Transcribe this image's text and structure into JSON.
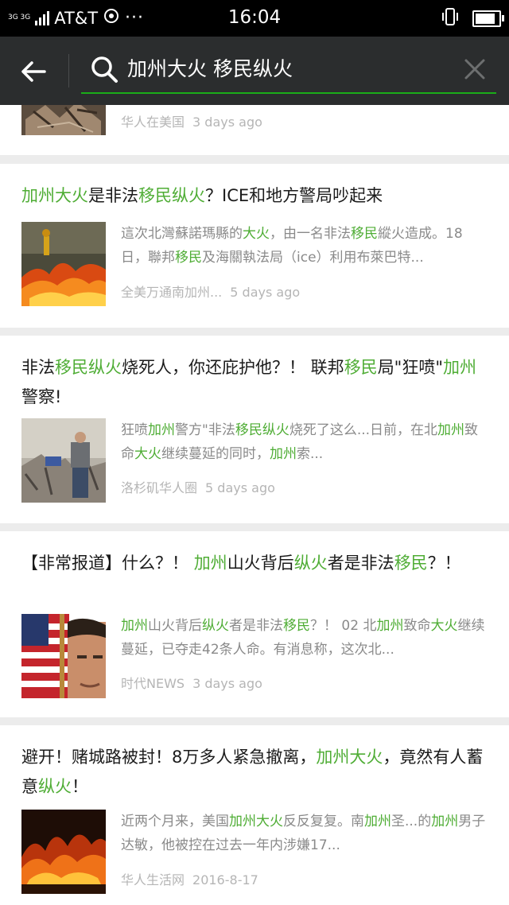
{
  "status_bar": {
    "network_type": "3G 3G",
    "carrier": "AT&T",
    "time": "16:04"
  },
  "search": {
    "query": "加州大火 移民纵火"
  },
  "results": [
    {
      "title": [],
      "snippet": [],
      "source": "华人在美国",
      "date": "3 days ago"
    },
    {
      "title": [
        {
          "t": "加州大火",
          "hl": true
        },
        {
          "t": "是非法",
          "hl": false
        },
        {
          "t": "移民纵火",
          "hl": true
        },
        {
          "t": "？ICE和地方警局吵起来",
          "hl": false
        }
      ],
      "snippet": [
        {
          "t": "這次北灣蘇諾瑪縣的",
          "hl": false
        },
        {
          "t": "大火",
          "hl": true
        },
        {
          "t": "，由一名非法",
          "hl": false
        },
        {
          "t": "移民",
          "hl": true
        },
        {
          "t": "縱火造成。18日，聯邦",
          "hl": false
        },
        {
          "t": "移民",
          "hl": true
        },
        {
          "t": "及海關執法局（ice）利用布萊巴特...",
          "hl": false
        }
      ],
      "source": "全美万通南加州...",
      "date": "5 days ago"
    },
    {
      "title": [
        {
          "t": "非法",
          "hl": false
        },
        {
          "t": "移民纵火",
          "hl": true
        },
        {
          "t": "烧死人，你还庇护他？！ 联邦",
          "hl": false
        },
        {
          "t": "移民",
          "hl": true
        },
        {
          "t": "局\"狂喷\"",
          "hl": false
        },
        {
          "t": "加州",
          "hl": true
        },
        {
          "t": "警察!",
          "hl": false
        }
      ],
      "snippet": [
        {
          "t": "狂喷",
          "hl": false
        },
        {
          "t": "加州",
          "hl": true
        },
        {
          "t": "警方\"非法",
          "hl": false
        },
        {
          "t": "移民纵火",
          "hl": true
        },
        {
          "t": "烧死了这么...日前，在北",
          "hl": false
        },
        {
          "t": "加州",
          "hl": true
        },
        {
          "t": "致命",
          "hl": false
        },
        {
          "t": "大火",
          "hl": true
        },
        {
          "t": "继续蔓延的同时，",
          "hl": false
        },
        {
          "t": "加州",
          "hl": true
        },
        {
          "t": "索...",
          "hl": false
        }
      ],
      "source": "洛杉矶华人圈",
      "date": "5 days ago"
    },
    {
      "title": [
        {
          "t": "【非常报道】什么？！ ",
          "hl": false
        },
        {
          "t": "加州",
          "hl": true
        },
        {
          "t": "山火背后",
          "hl": false
        },
        {
          "t": "纵火",
          "hl": true
        },
        {
          "t": "者是非法",
          "hl": false
        },
        {
          "t": "移民",
          "hl": true
        },
        {
          "t": "？！",
          "hl": false
        }
      ],
      "snippet": [
        {
          "t": "加州",
          "hl": true
        },
        {
          "t": "山火背后",
          "hl": false
        },
        {
          "t": "纵火",
          "hl": true
        },
        {
          "t": "者是非法",
          "hl": false
        },
        {
          "t": "移民",
          "hl": true
        },
        {
          "t": "？！ 02 北",
          "hl": false
        },
        {
          "t": "加州",
          "hl": true
        },
        {
          "t": "致命",
          "hl": false
        },
        {
          "t": "大火",
          "hl": true
        },
        {
          "t": "继续蔓延，已夺走42条人命。有消息称，这次北...",
          "hl": false
        }
      ],
      "source": "时代NEWS",
      "date": "3 days ago"
    },
    {
      "title": [
        {
          "t": "避开！赌城路被封！8万多人紧急撤离，",
          "hl": false
        },
        {
          "t": "加州大火",
          "hl": true
        },
        {
          "t": "，竟然有人蓄意",
          "hl": false
        },
        {
          "t": "纵火",
          "hl": true
        },
        {
          "t": "！",
          "hl": false
        }
      ],
      "snippet": [
        {
          "t": "近两个月来，美国",
          "hl": false
        },
        {
          "t": "加州大火",
          "hl": true
        },
        {
          "t": "反反复复。南",
          "hl": false
        },
        {
          "t": "加州",
          "hl": true
        },
        {
          "t": "圣...的",
          "hl": false
        },
        {
          "t": "加州",
          "hl": true
        },
        {
          "t": "男子达敏，他被控在过去一年内涉嫌17...",
          "hl": false
        }
      ],
      "source": "华人生活网",
      "date": "2016-8-17"
    }
  ],
  "colors": {
    "highlight": "#4fad35",
    "accent_underline": "#1aad19",
    "header_bg": "#2b2d2e"
  },
  "icons": [
    "back-arrow-icon",
    "search-icon",
    "clear-icon",
    "wifi-calling-icon",
    "vibrate-icon",
    "battery-icon"
  ]
}
